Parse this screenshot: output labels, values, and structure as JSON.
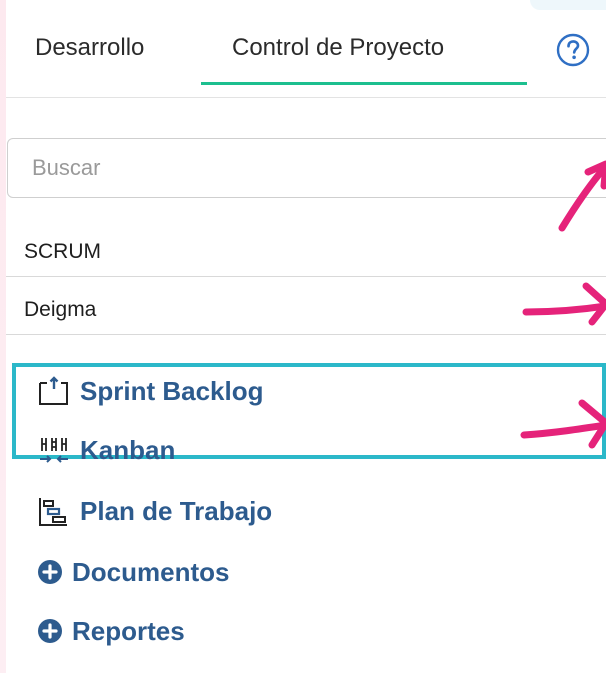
{
  "tabs": [
    {
      "label": "Desarrollo",
      "active": false
    },
    {
      "label": "Control de Proyecto",
      "active": true
    }
  ],
  "search": {
    "placeholder": "Buscar",
    "value": ""
  },
  "projects": [
    "SCRUM",
    "Deigma"
  ],
  "nav": {
    "sprint_backlog": "Sprint Backlog",
    "kanban": "Kanban",
    "plan_trabajo": "Plan de Trabajo",
    "documentos": "Documentos",
    "reportes": "Reportes"
  },
  "icons": {
    "help": "help-icon",
    "sprint_backlog": "backlog-icon",
    "kanban": "kanban-board-icon",
    "plan_trabajo": "gantt-icon",
    "documentos": "plus-circle-icon",
    "reportes": "plus-circle-icon"
  },
  "colors": {
    "tab_underline": "#1dbf8f",
    "link": "#2d5b8e",
    "highlight_border": "#2bb8c9",
    "annotation_arrow": "#e5237a",
    "help_icon": "#2f6fc4"
  }
}
